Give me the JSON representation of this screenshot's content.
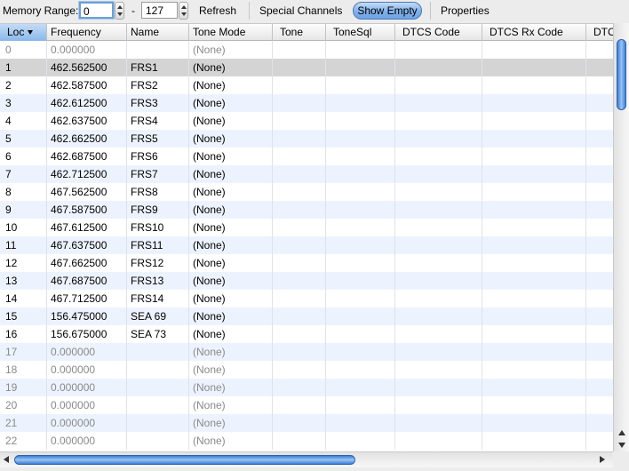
{
  "toolbar": {
    "memory_range_label": "Memory Range:",
    "range_start": "0",
    "range_separator": "-",
    "range_end": "127",
    "refresh_label": "Refresh",
    "special_channels_label": "Special Channels",
    "show_empty_label": "Show Empty",
    "properties_label": "Properties"
  },
  "table": {
    "columns": [
      "Loc",
      "Frequency",
      "Name",
      "Tone Mode",
      "Tone",
      "ToneSql",
      "DTCS Code",
      "DTCS Rx Code",
      "DTCS"
    ],
    "sort_column": "Loc",
    "selected_row": 1,
    "rows": [
      {
        "loc": "0",
        "freq": "0.000000",
        "name": "",
        "tone_mode": "(None)",
        "empty": true
      },
      {
        "loc": "1",
        "freq": "462.562500",
        "name": "FRS1",
        "tone_mode": "(None)",
        "empty": false
      },
      {
        "loc": "2",
        "freq": "462.587500",
        "name": "FRS2",
        "tone_mode": "(None)",
        "empty": false
      },
      {
        "loc": "3",
        "freq": "462.612500",
        "name": "FRS3",
        "tone_mode": "(None)",
        "empty": false
      },
      {
        "loc": "4",
        "freq": "462.637500",
        "name": "FRS4",
        "tone_mode": "(None)",
        "empty": false
      },
      {
        "loc": "5",
        "freq": "462.662500",
        "name": "FRS5",
        "tone_mode": "(None)",
        "empty": false
      },
      {
        "loc": "6",
        "freq": "462.687500",
        "name": "FRS6",
        "tone_mode": "(None)",
        "empty": false
      },
      {
        "loc": "7",
        "freq": "462.712500",
        "name": "FRS7",
        "tone_mode": "(None)",
        "empty": false
      },
      {
        "loc": "8",
        "freq": "467.562500",
        "name": "FRS8",
        "tone_mode": "(None)",
        "empty": false
      },
      {
        "loc": "9",
        "freq": "467.587500",
        "name": "FRS9",
        "tone_mode": "(None)",
        "empty": false
      },
      {
        "loc": "10",
        "freq": "467.612500",
        "name": "FRS10",
        "tone_mode": "(None)",
        "empty": false
      },
      {
        "loc": "11",
        "freq": "467.637500",
        "name": "FRS11",
        "tone_mode": "(None)",
        "empty": false
      },
      {
        "loc": "12",
        "freq": "467.662500",
        "name": "FRS12",
        "tone_mode": "(None)",
        "empty": false
      },
      {
        "loc": "13",
        "freq": "467.687500",
        "name": "FRS13",
        "tone_mode": "(None)",
        "empty": false
      },
      {
        "loc": "14",
        "freq": "467.712500",
        "name": "FRS14",
        "tone_mode": "(None)",
        "empty": false
      },
      {
        "loc": "15",
        "freq": "156.475000",
        "name": "SEA 69",
        "tone_mode": "(None)",
        "empty": false
      },
      {
        "loc": "16",
        "freq": "156.675000",
        "name": "SEA 73",
        "tone_mode": "(None)",
        "empty": false
      },
      {
        "loc": "17",
        "freq": "0.000000",
        "name": "",
        "tone_mode": "(None)",
        "empty": true
      },
      {
        "loc": "18",
        "freq": "0.000000",
        "name": "",
        "tone_mode": "(None)",
        "empty": true
      },
      {
        "loc": "19",
        "freq": "0.000000",
        "name": "",
        "tone_mode": "(None)",
        "empty": true
      },
      {
        "loc": "20",
        "freq": "0.000000",
        "name": "",
        "tone_mode": "(None)",
        "empty": true
      },
      {
        "loc": "21",
        "freq": "0.000000",
        "name": "",
        "tone_mode": "(None)",
        "empty": true
      },
      {
        "loc": "22",
        "freq": "0.000000",
        "name": "",
        "tone_mode": "(None)",
        "empty": true
      }
    ]
  },
  "colors": {
    "row_alt": "#edf3fe",
    "row_selected": "#d4d4d4",
    "accent": "#6ea4e6",
    "empty_text": "#8a8a8a"
  }
}
